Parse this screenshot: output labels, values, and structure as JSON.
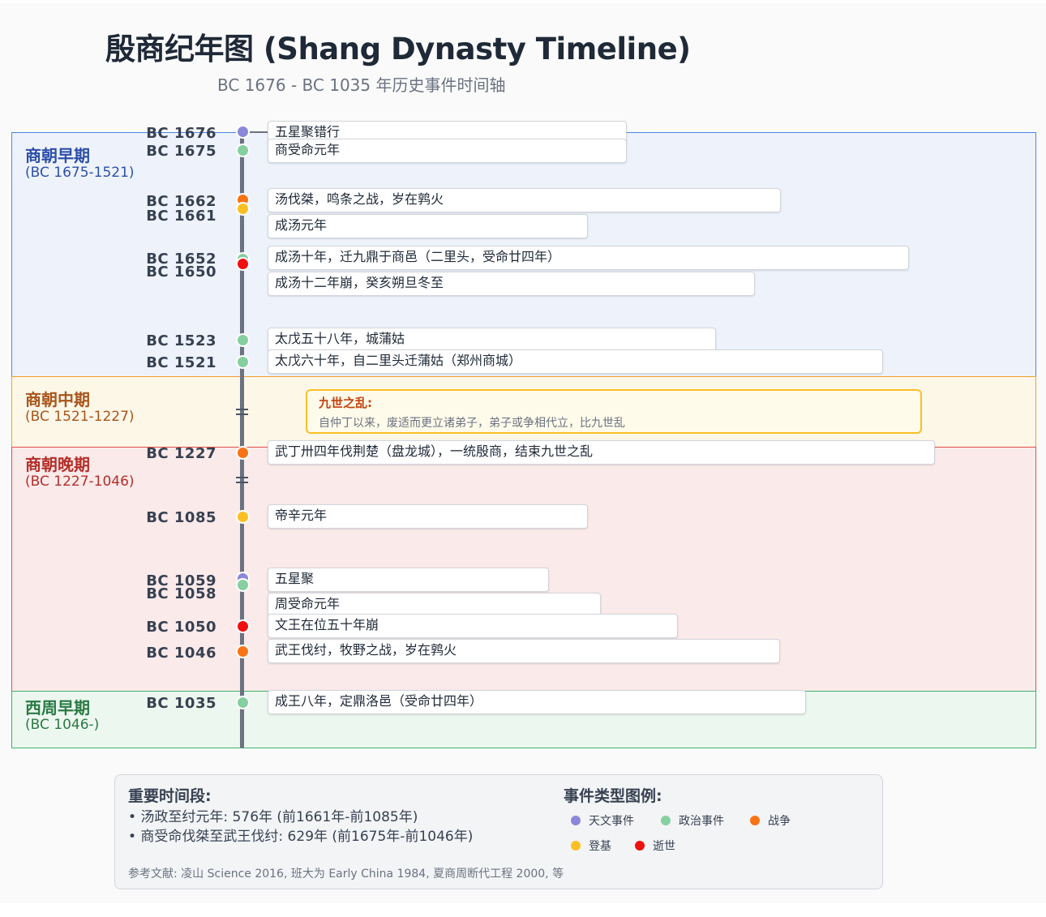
{
  "title": "殷商纪年图 (Shang Dynasty Timeline)",
  "subtitle": "BC 1676 - BC 1035 年历史事件时间轴",
  "colors": {
    "astronomy": "#8b87d9",
    "politics": "#86cfa0",
    "war": "#f97316",
    "accession": "#fbbf24",
    "death": "#ef1010"
  },
  "periods": [
    {
      "name": "商朝早期",
      "range": "(BC 1675-1521)",
      "border": "#4a86e8",
      "bg": "#eef3fb",
      "text": "#2d4fa8"
    },
    {
      "name": "商朝中期",
      "range": "(BC 1521-1227)",
      "border": "#f0a030",
      "bg": "#fdf7e8",
      "text": "#a8561c"
    },
    {
      "name": "商朝晚期",
      "range": "(BC 1227-1046)",
      "border": "#e0504a",
      "bg": "#fbeaea",
      "text": "#b42f2a"
    },
    {
      "name": "西周早期",
      "range": "(BC 1046-)",
      "border": "#3db36a",
      "bg": "#ecf7ef",
      "text": "#2a7a44"
    }
  ],
  "events": [
    {
      "year": "BC 1676",
      "text": "五星聚错行",
      "type": "astronomy"
    },
    {
      "year": "BC 1675",
      "text": "商受命元年",
      "type": "politics"
    },
    {
      "year": "BC 1662",
      "text": "汤伐桀，鸣条之战，岁在鹑火",
      "type": "war"
    },
    {
      "year": "BC 1661",
      "text": "成汤元年",
      "type": "accession"
    },
    {
      "year": "BC 1652",
      "text": "成汤十年，迁九鼎于商邑（二里头，受命廿四年）",
      "type": "politics"
    },
    {
      "year": "BC 1650",
      "text": "成汤十二年崩，癸亥朔旦冬至",
      "type": "death"
    },
    {
      "year": "BC 1523",
      "text": "太戊五十八年，城蒲姑",
      "type": "politics"
    },
    {
      "year": "BC 1521",
      "text": "太戊六十年，自二里头迁蒲姑（郑州商城）",
      "type": "politics"
    },
    {
      "year": "BC 1227",
      "text": "武丁卅四年伐荆楚（盘龙城），一统殷商，结束九世之乱",
      "type": "war"
    },
    {
      "year": "BC 1085",
      "text": "帝辛元年",
      "type": "accession"
    },
    {
      "year": "BC 1059",
      "text": "五星聚",
      "type": "astronomy"
    },
    {
      "year": "BC 1058",
      "text": "周受命元年",
      "type": "politics"
    },
    {
      "year": "BC 1050",
      "text": "文王在位五十年崩",
      "type": "death"
    },
    {
      "year": "BC 1046",
      "text": "武王伐纣，牧野之战，岁在鹑火",
      "type": "war"
    },
    {
      "year": "BC 1035",
      "text": "成王八年，定鼎洛邑（受命廿四年）",
      "type": "politics"
    }
  ],
  "chaos": {
    "title": "九世之乱:",
    "desc": "自仲丁以来，废适而更立诸弟子，弟子或争相代立，比九世乱"
  },
  "legend": {
    "periods_title": "重要时间段:",
    "periods": [
      "• 汤政至纣元年: 576年 (前1661年-前1085年)",
      "• 商受命伐桀至武王伐纣: 629年 (前1675年-前1046年)"
    ],
    "types_title": "事件类型图例:",
    "types": [
      {
        "type": "astronomy",
        "label": "天文事件"
      },
      {
        "type": "politics",
        "label": "政治事件"
      },
      {
        "type": "war",
        "label": "战争"
      },
      {
        "type": "accession",
        "label": "登基"
      },
      {
        "type": "death",
        "label": "逝世"
      }
    ],
    "reference": "参考文献: 凌山 Science 2016, 班大为 Early China 1984, 夏商周断代工程 2000, 等"
  }
}
